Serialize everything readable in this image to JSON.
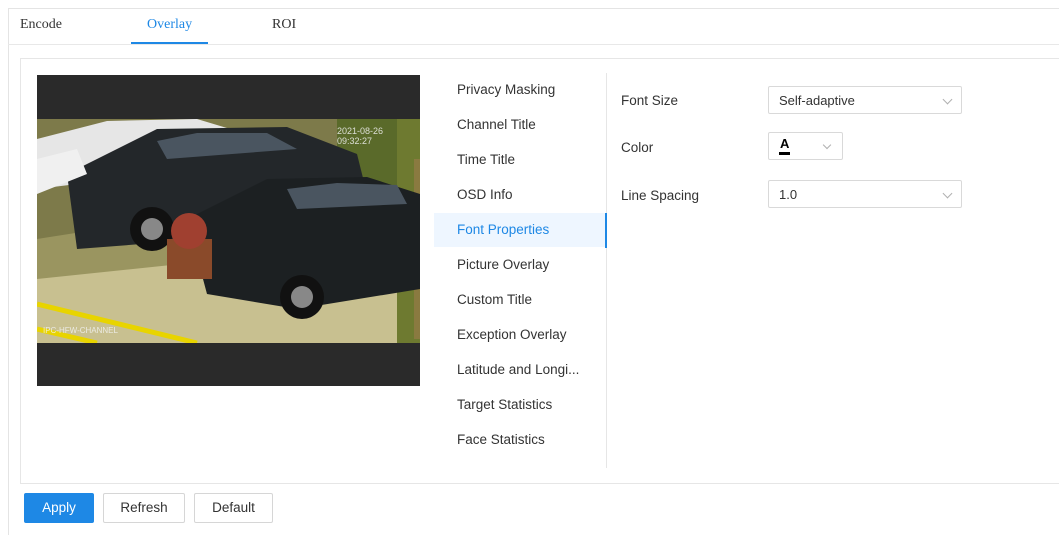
{
  "tabs": [
    {
      "label": "Encode"
    },
    {
      "label": "Overlay"
    },
    {
      "label": "ROI"
    }
  ],
  "active_tab": "Overlay",
  "preview": {
    "timestamp": "2021-08-26 09:32:27",
    "channel_title": "IPC-HFW-CHANNEL"
  },
  "menu": {
    "items": [
      {
        "label": "Privacy Masking"
      },
      {
        "label": "Channel Title"
      },
      {
        "label": "Time Title"
      },
      {
        "label": "OSD Info"
      },
      {
        "label": "Font Properties"
      },
      {
        "label": "Picture Overlay"
      },
      {
        "label": "Custom Title"
      },
      {
        "label": "Exception Overlay"
      },
      {
        "label": "Latitude and Longi..."
      },
      {
        "label": "Target Statistics"
      },
      {
        "label": "Face Statistics"
      }
    ],
    "active": "Font Properties"
  },
  "form": {
    "font_size_label": "Font Size",
    "font_size_value": "Self-adaptive",
    "color_label": "Color",
    "color_glyph": "A",
    "color_value": "#000000",
    "line_spacing_label": "Line Spacing",
    "line_spacing_value": "1.0"
  },
  "buttons": {
    "apply": "Apply",
    "refresh": "Refresh",
    "default": "Default"
  },
  "colors": {
    "accent": "#1e88e5"
  }
}
